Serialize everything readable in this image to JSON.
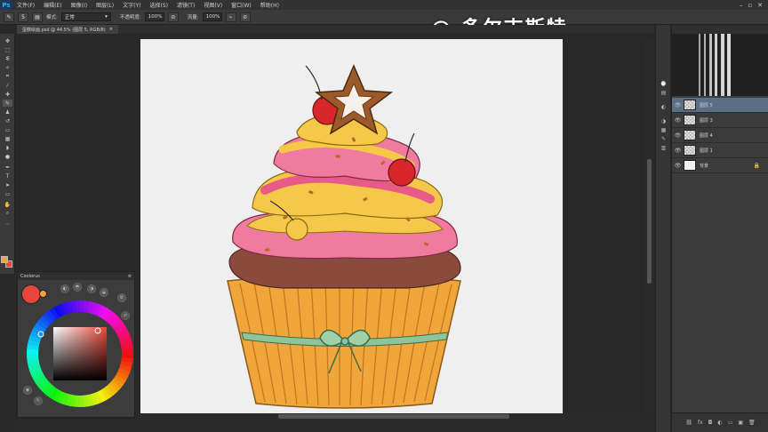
{
  "app": {
    "logo": "Ps"
  },
  "menu": {
    "items": [
      "文件(F)",
      "编辑(E)",
      "图像(I)",
      "图层(L)",
      "文字(Y)",
      "选择(S)",
      "滤镜(T)",
      "视图(V)",
      "窗口(W)",
      "帮助(H)"
    ],
    "window_controls": {
      "minimize": "–",
      "maximize": "▫",
      "close": "✕"
    }
  },
  "options": {
    "mode_label": "模式:",
    "mode_value": "正常",
    "opacity_label": "不透明度:",
    "opacity_value": "100%",
    "flow_label": "流量:",
    "flow_value": "100%",
    "brush_size": "5"
  },
  "watermark": "@  多尔吉斯特",
  "document": {
    "tab_title": "蛋糕绘画.psd @ 44.5% (图层 5, RGB/8)",
    "tab_close": "×"
  },
  "coolorus": {
    "title": "Coolorus",
    "current_color": "#e8463a",
    "previous_color": "#f0a43a"
  },
  "layers": {
    "items": [
      {
        "name": "图层 5",
        "active": true,
        "thumb": "checker"
      },
      {
        "name": "图层 3",
        "active": false,
        "thumb": "checker"
      },
      {
        "name": "图层 4",
        "active": false,
        "thumb": "checker"
      },
      {
        "name": "图层 1",
        "active": false,
        "thumb": "checker"
      },
      {
        "name": "背景",
        "active": false,
        "thumb": "white",
        "locked": true
      }
    ],
    "footer_icons": [
      "link-icon",
      "fx-icon",
      "mask-icon",
      "adjustment-icon",
      "folder-icon",
      "new-layer-icon",
      "trash-icon"
    ]
  },
  "colors": {
    "ui_bg": "#282828",
    "panel_bg": "#3b3b3b",
    "canvas_bg": "#efefef",
    "active_layer": "#5a6f86"
  }
}
